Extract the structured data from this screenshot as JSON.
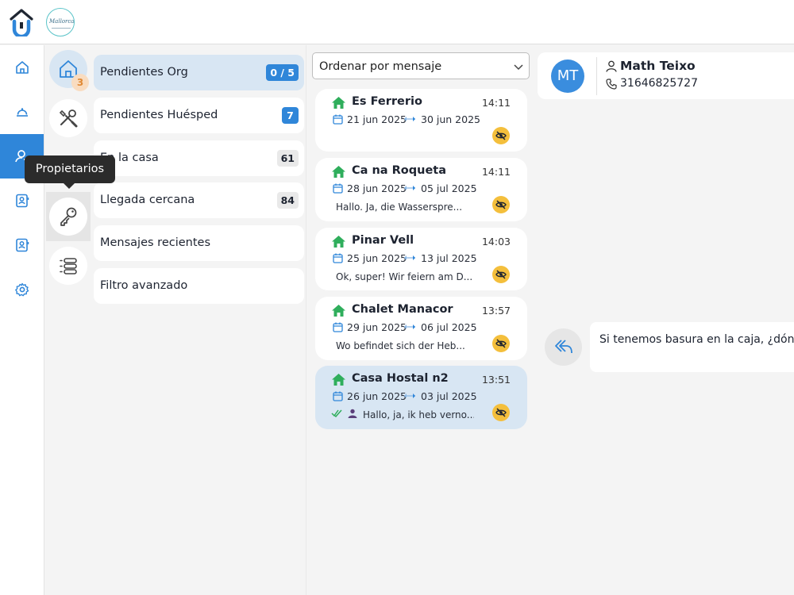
{
  "brand": {
    "script_text": "Mallorca"
  },
  "sidebar": {
    "items": [
      {
        "name": "home-icon"
      },
      {
        "name": "bell-icon"
      },
      {
        "name": "owners-icon",
        "active": true
      },
      {
        "name": "contacts-icon"
      },
      {
        "name": "contacts-alt-icon"
      },
      {
        "name": "gear-icon"
      }
    ]
  },
  "categories": [
    {
      "name": "home-icon",
      "badge": "3"
    },
    {
      "name": "tools-icon"
    },
    {
      "name": "key-icon"
    },
    {
      "name": "list-icon"
    }
  ],
  "tooltip": {
    "text": "Propietarios"
  },
  "filters": [
    {
      "label": "Pendientes Org",
      "count": "0 / 5",
      "selected": true
    },
    {
      "label": "Pendientes Huésped",
      "count": "7"
    },
    {
      "label": "En la casa",
      "count": "61"
    },
    {
      "label": "Llegada cercana",
      "count": "84"
    },
    {
      "label": "Mensajes recientes",
      "count": ""
    },
    {
      "label": "Filtro avanzado",
      "count": ""
    }
  ],
  "sort": {
    "selected": "Ordenar por mensaje"
  },
  "conversations": [
    {
      "property": "Es Ferrerio",
      "time": "14:11",
      "checkin": "21 jun 2025",
      "checkout": "30 jun 2025",
      "preview": ""
    },
    {
      "property": "Ca na Roqueta",
      "time": "14:11",
      "checkin": "28 jun 2025",
      "checkout": "05 jul 2025",
      "preview": "Hallo. Ja, die Wasserspre..."
    },
    {
      "property": "Pinar Vell",
      "time": "14:03",
      "checkin": "25 jun 2025",
      "checkout": "13 jul 2025",
      "preview": "Ok, super! Wir feiern am D..."
    },
    {
      "property": "Chalet Manacor",
      "time": "13:57",
      "checkin": "29 jun 2025",
      "checkout": "06 jul 2025",
      "preview": "Wo befindet sich der Heb..."
    },
    {
      "property": "Casa Hostal n2",
      "time": "13:51",
      "checkin": "26 jun 2025",
      "checkout": "03 jul 2025",
      "preview": "Hallo, ja, ik heb verno...",
      "selected": true
    }
  ],
  "chat": {
    "avatar_initials": "MT",
    "contact_name": "Math Teixo",
    "contact_phone": "31646825727",
    "message": "Si tenemos basura en la caja, ¿dónde"
  },
  "colors": {
    "accent": "#2f86d9",
    "selected_bg": "#d8e6f3",
    "house_green": "#2fae5c",
    "eye_badge": "#f4bf3c",
    "badge_orange": "#e08a36"
  }
}
